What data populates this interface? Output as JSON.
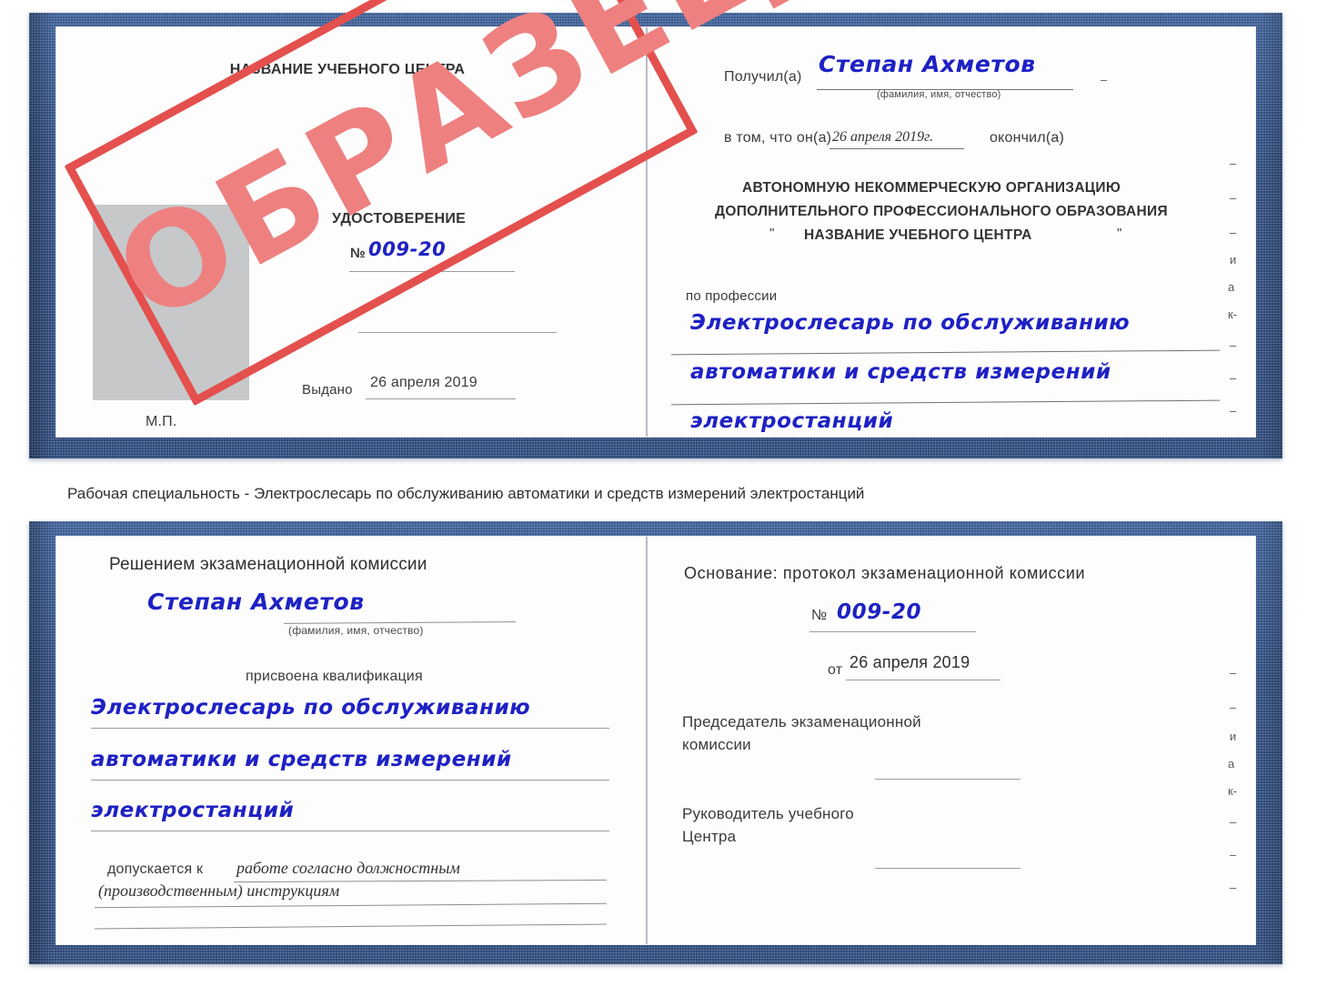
{
  "caption": "Рабочая специальность - Электрослесарь по обслуживанию автоматики и средств измерений электростанций",
  "stamp": {
    "text": "ОБРАЗЕЦ",
    "border_color": "#e3504e",
    "text_color": "#ee8080"
  },
  "colors": {
    "cover_blue": "#2c4a7c",
    "handwriting_blue": "#1e21c4",
    "page_white": "#fdfdfd",
    "photo_placeholder_gray": "#c6c8ca",
    "rule_gray": "#9a9da3"
  },
  "certificate_top": {
    "left_page": {
      "center_title": "НАЗВАНИЕ УЧЕБНОГО ЦЕНТРА",
      "doc_type": "УДОСТОВЕРЕНИЕ",
      "number_label": "№",
      "number_value": "009-20",
      "issued_label": "Выдано",
      "issued_value": "26 апреля 2019",
      "seal_label": "М.П."
    },
    "right_page": {
      "received_label": "Получил(а)",
      "received_value": "Степан Ахметов",
      "received_hint": "(фамилия, имя, отчество)",
      "in_that_label": "в том, что он(а)",
      "in_that_value": "26 апреля 2019г.",
      "finished_label": "окончил(а)",
      "organization_lines": [
        "АВТОНОМНУЮ НЕКОММЕРЧЕСКУЮ ОРГАНИЗАЦИЮ",
        "ДОПОЛНИТЕЛЬНОГО ПРОФЕССИОНАЛЬНОГО ОБРАЗОВАНИЯ"
      ],
      "organization_quote_open": "\"",
      "organization_name": "НАЗВАНИЕ УЧЕБНОГО ЦЕНТРА",
      "organization_quote_close": "\"",
      "profession_label": "по профессии",
      "profession_lines": [
        "Электрослесарь по обслуживанию",
        "автоматики и средств измерений",
        "электростанций"
      ],
      "margin_fragments": [
        "–",
        "–",
        "–",
        "и",
        "а",
        "к-",
        "–",
        "–",
        "–"
      ]
    }
  },
  "certificate_bottom": {
    "left_page": {
      "decision_title": "Решением экзаменационной комиссии",
      "name_value": "Степан Ахметов",
      "name_hint": "(фамилия, имя, отчество)",
      "qualification_label": "присвоена квалификация",
      "qualification_lines": [
        "Электрослесарь по обслуживанию",
        "автоматики и средств измерений",
        "электростанций"
      ],
      "allowed_label": "допускается к",
      "allowed_value_line1": "работе согласно должностным",
      "allowed_value_line2": "(производственным) инструкциям"
    },
    "right_page": {
      "basis_label": "Основание: протокол экзаменационной комиссии",
      "number_label": "№",
      "number_value": "009-20",
      "date_label": "от",
      "date_value": "26 апреля 2019",
      "chairman_line1": "Председатель экзаменационной",
      "chairman_line2": "комиссии",
      "head_line1": "Руководитель учебного",
      "head_line2": "Центра",
      "margin_fragments": [
        "–",
        "–",
        "и",
        "а",
        "к-",
        "–",
        "–",
        "–"
      ]
    }
  }
}
